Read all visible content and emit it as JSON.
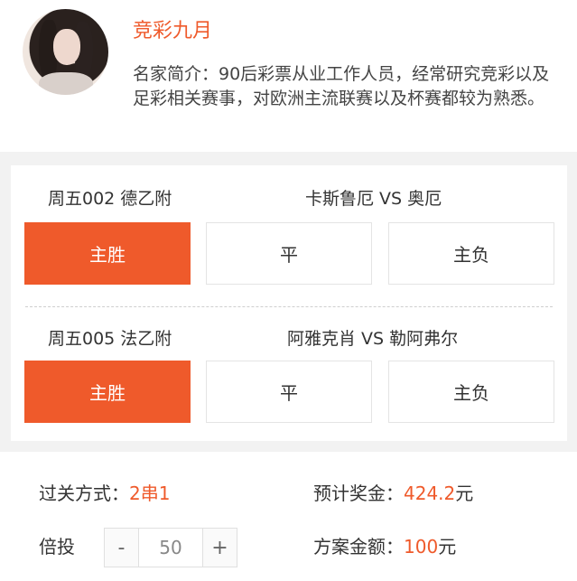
{
  "expert": {
    "name": "竞彩九月",
    "intro": "名家简介：90后彩票从业工作人员，经常研究竞彩以及足彩相关赛事，对欧洲主流联赛以及杯赛都较为熟悉。"
  },
  "matches": [
    {
      "code": "周五002 德乙附",
      "teams": "卡斯鲁厄 VS 奥厄",
      "options": [
        "主胜",
        "平",
        "主负"
      ],
      "selected": "主胜"
    },
    {
      "code": "周五005 法乙附",
      "teams": "阿雅克肖 VS 勒阿弗尔",
      "options": [
        "主胜",
        "平",
        "主负"
      ],
      "selected": "主胜"
    }
  ],
  "summary": {
    "pass_type_label": "过关方式：",
    "pass_type_value": "2串1",
    "prize_label": "预计奖金：",
    "prize_value": "424.2",
    "prize_unit": "元",
    "multiplier_label": "倍投",
    "multiplier_minus": "-",
    "multiplier_value": "50",
    "multiplier_plus": "+",
    "amount_label": "方案金额：",
    "amount_value": "100",
    "amount_unit": "元"
  },
  "colors": {
    "accent": "#ef5a2b",
    "background": "#f2f2f2"
  }
}
